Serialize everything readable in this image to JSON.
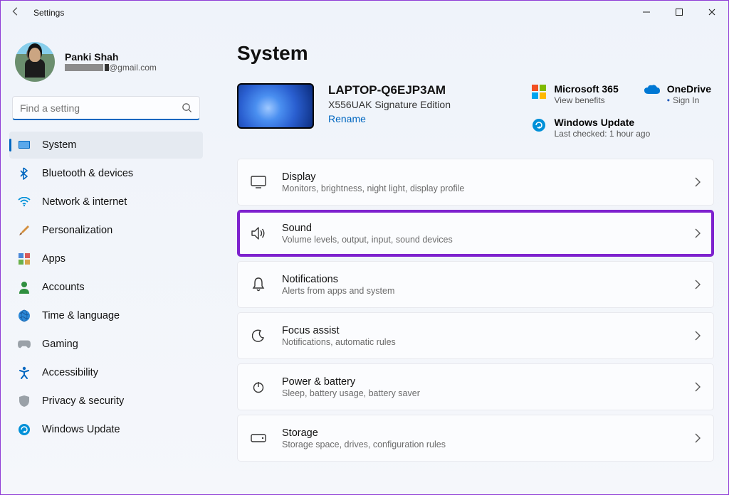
{
  "window": {
    "title": "Settings"
  },
  "profile": {
    "name": "Panki Shah",
    "email_suffix": "@gmail.com"
  },
  "search": {
    "placeholder": "Find a setting"
  },
  "sidebar": {
    "items": [
      {
        "label": "System"
      },
      {
        "label": "Bluetooth & devices"
      },
      {
        "label": "Network & internet"
      },
      {
        "label": "Personalization"
      },
      {
        "label": "Apps"
      },
      {
        "label": "Accounts"
      },
      {
        "label": "Time & language"
      },
      {
        "label": "Gaming"
      },
      {
        "label": "Accessibility"
      },
      {
        "label": "Privacy & security"
      },
      {
        "label": "Windows Update"
      }
    ]
  },
  "main": {
    "page_title": "System",
    "device": {
      "name": "LAPTOP-Q6EJP3AM",
      "model": "X556UAK Signature Edition",
      "rename": "Rename"
    },
    "quick": {
      "ms365": {
        "title": "Microsoft 365",
        "sub": "View benefits"
      },
      "onedrive": {
        "title": "OneDrive",
        "sub": "Sign In"
      },
      "update": {
        "title": "Windows Update",
        "sub": "Last checked: 1 hour ago"
      }
    },
    "cards": [
      {
        "title": "Display",
        "sub": "Monitors, brightness, night light, display profile"
      },
      {
        "title": "Sound",
        "sub": "Volume levels, output, input, sound devices"
      },
      {
        "title": "Notifications",
        "sub": "Alerts from apps and system"
      },
      {
        "title": "Focus assist",
        "sub": "Notifications, automatic rules"
      },
      {
        "title": "Power & battery",
        "sub": "Sleep, battery usage, battery saver"
      },
      {
        "title": "Storage",
        "sub": "Storage space, drives, configuration rules"
      }
    ]
  }
}
